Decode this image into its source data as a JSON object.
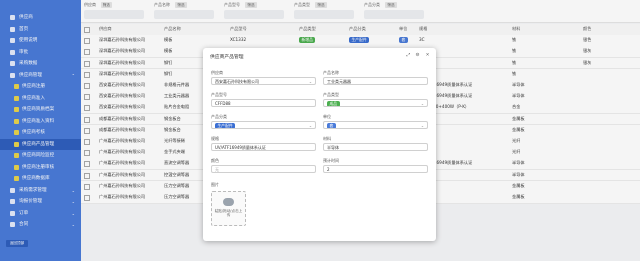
{
  "sidebar": {
    "items": [
      {
        "label": "供应商",
        "type": "top",
        "arrow": ""
      },
      {
        "label": "首页",
        "type": "top",
        "arrow": ""
      },
      {
        "label": "使用说明",
        "type": "top",
        "arrow": ""
      },
      {
        "label": "审批",
        "type": "top",
        "arrow": ""
      },
      {
        "label": "采购数据",
        "type": "top",
        "arrow": ""
      },
      {
        "label": "供应商管理",
        "type": "top",
        "arrow": "⌃"
      },
      {
        "label": "供应商注册",
        "type": "sub",
        "arrow": ""
      },
      {
        "label": "供应商准入",
        "type": "sub",
        "arrow": ""
      },
      {
        "label": "供应商资质档案",
        "type": "sub",
        "arrow": ""
      },
      {
        "label": "供应商准入资料",
        "type": "sub",
        "arrow": ""
      },
      {
        "label": "供应商考核",
        "type": "sub",
        "arrow": ""
      },
      {
        "label": "供应商产品管理",
        "type": "sub",
        "arrow": "",
        "active": true
      },
      {
        "label": "供应商风险监控",
        "type": "sub",
        "arrow": ""
      },
      {
        "label": "供应商注册审核",
        "type": "sub",
        "arrow": ""
      },
      {
        "label": "供应商数据库",
        "type": "sub",
        "arrow": ""
      },
      {
        "label": "采购需求管理",
        "type": "top",
        "arrow": "⌄"
      },
      {
        "label": "询报价管理",
        "type": "top",
        "arrow": "⌄"
      },
      {
        "label": "订单",
        "type": "top",
        "arrow": "⌄"
      },
      {
        "label": "合同",
        "type": "top",
        "arrow": "⌄"
      }
    ],
    "footer_label": "返回顶部"
  },
  "filters": [
    {
      "label": "供应商",
      "tag": "筛选"
    },
    {
      "label": "产品名称",
      "tag": "筛选"
    },
    {
      "label": "产品型号",
      "tag": "筛选"
    },
    {
      "label": "产品类型",
      "tag": "筛选"
    },
    {
      "label": "产品分类",
      "tag": "筛选"
    }
  ],
  "table": {
    "headers": [
      "供应商",
      "产品名称",
      "产品型号",
      "产品类型",
      "产品分类",
      "单位",
      "规格",
      "材料",
      "颜色"
    ],
    "rows": [
      [
        "深圳嘉石孙科技有限公司",
        "模板",
        "XC1332",
        "新增品",
        "生产配件",
        "套",
        "3C",
        "铁",
        "银色"
      ],
      [
        "深圳嘉石孙科技有限公司",
        "模板",
        "XC1332",
        "",
        "生产配件",
        "",
        "SDC",
        "铁",
        "银灰"
      ],
      [
        "深圳嘉石孙科技有限公司",
        "铆钉",
        "",
        "",
        "",
        "",
        "SDC",
        "铁",
        "银灰"
      ],
      [
        "深圳嘉石孙科技有限公司",
        "铆钉",
        "",
        "",
        "",
        "",
        "SDC",
        "铁",
        ""
      ],
      [
        "西安嘉石孙科技有限公司",
        "非规格元件器",
        "",
        "",
        "",
        "",
        "UV/ATF16949质量体系认证",
        "半导体",
        ""
      ],
      [
        "西安嘉石孙科技有限公司",
        "工业类元器器",
        "",
        "",
        "",
        "",
        "UV/ATF16949质量体系认证",
        "半导体",
        ""
      ],
      [
        "西安嘉石孙科技有限公司",
        "贴片合金电阻",
        "",
        "",
        "",
        "",
        "额外系列0+400W（P-K）",
        "合金",
        ""
      ],
      [
        "成都嘉石孙科技有限公司",
        "钢金板台",
        "",
        "",
        "",
        "",
        "XCDD",
        "金属板",
        ""
      ],
      [
        "成都嘉石孙科技有限公司",
        "钢金板台",
        "",
        "",
        "",
        "",
        "XCDD",
        "金属板",
        ""
      ],
      [
        "广州嘉石孙科技有限公司",
        "光纤等接稀",
        "",
        "",
        "",
        "",
        "XSGDH",
        "光纤",
        ""
      ],
      [
        "广州嘉石孙科技有限公司",
        "金手式夹端",
        "",
        "",
        "",
        "",
        "PDGH",
        "光纤",
        ""
      ],
      [
        "广州嘉石孙科技有限公司",
        "直流空调等器",
        "",
        "",
        "",
        "",
        "UV/ATF16949质量体系认证",
        "半导体",
        ""
      ],
      [
        "广州嘉石孙科技有限公司",
        "控温空调等器",
        "",
        "",
        "",
        "",
        "一级代理",
        "半导体",
        ""
      ],
      [
        "广州嘉石孙科技有限公司",
        "压力空调等器",
        "",
        "",
        "",
        "",
        "一级代理",
        "金属板",
        ""
      ],
      [
        "广州嘉石孙科技有限公司",
        "压力空调等器",
        "",
        "",
        "",
        "",
        "一级代理",
        "金属板",
        ""
      ]
    ]
  },
  "modal": {
    "title": "供应商产品管理",
    "fields": {
      "supplier": {
        "label": "供应商",
        "value": "西安嘉石孙科技有限公司"
      },
      "product_name": {
        "label": "产品名称",
        "value": "工业类元器器"
      },
      "product_model": {
        "label": "产品型号",
        "value": "CFFD88"
      },
      "product_type": {
        "label": "产品类型",
        "value": "成品"
      },
      "product_category": {
        "label": "产品分类",
        "value": "生产配件"
      },
      "unit": {
        "label": "单位",
        "value": "套"
      },
      "spec": {
        "label": "规格",
        "value": "UV/ATF16949质量体系认证"
      },
      "material": {
        "label": "材料",
        "value": "半导体"
      },
      "color": {
        "label": "颜色",
        "placeholder": "无"
      },
      "lead_time": {
        "label": "预计时间",
        "value": "2"
      },
      "image": {
        "label": "图片",
        "upload_text": "粘贴/拖动/点击上传"
      }
    }
  }
}
